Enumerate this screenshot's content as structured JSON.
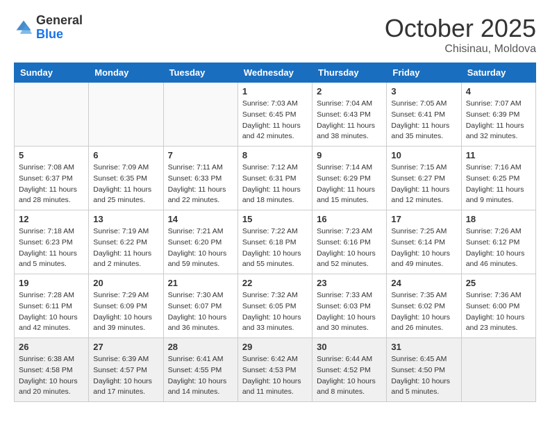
{
  "header": {
    "logo_general": "General",
    "logo_blue": "Blue",
    "month": "October 2025",
    "location": "Chisinau, Moldova"
  },
  "weekdays": [
    "Sunday",
    "Monday",
    "Tuesday",
    "Wednesday",
    "Thursday",
    "Friday",
    "Saturday"
  ],
  "weeks": [
    [
      {
        "day": "",
        "info": ""
      },
      {
        "day": "",
        "info": ""
      },
      {
        "day": "",
        "info": ""
      },
      {
        "day": "1",
        "info": "Sunrise: 7:03 AM\nSunset: 6:45 PM\nDaylight: 11 hours\nand 42 minutes."
      },
      {
        "day": "2",
        "info": "Sunrise: 7:04 AM\nSunset: 6:43 PM\nDaylight: 11 hours\nand 38 minutes."
      },
      {
        "day": "3",
        "info": "Sunrise: 7:05 AM\nSunset: 6:41 PM\nDaylight: 11 hours\nand 35 minutes."
      },
      {
        "day": "4",
        "info": "Sunrise: 7:07 AM\nSunset: 6:39 PM\nDaylight: 11 hours\nand 32 minutes."
      }
    ],
    [
      {
        "day": "5",
        "info": "Sunrise: 7:08 AM\nSunset: 6:37 PM\nDaylight: 11 hours\nand 28 minutes."
      },
      {
        "day": "6",
        "info": "Sunrise: 7:09 AM\nSunset: 6:35 PM\nDaylight: 11 hours\nand 25 minutes."
      },
      {
        "day": "7",
        "info": "Sunrise: 7:11 AM\nSunset: 6:33 PM\nDaylight: 11 hours\nand 22 minutes."
      },
      {
        "day": "8",
        "info": "Sunrise: 7:12 AM\nSunset: 6:31 PM\nDaylight: 11 hours\nand 18 minutes."
      },
      {
        "day": "9",
        "info": "Sunrise: 7:14 AM\nSunset: 6:29 PM\nDaylight: 11 hours\nand 15 minutes."
      },
      {
        "day": "10",
        "info": "Sunrise: 7:15 AM\nSunset: 6:27 PM\nDaylight: 11 hours\nand 12 minutes."
      },
      {
        "day": "11",
        "info": "Sunrise: 7:16 AM\nSunset: 6:25 PM\nDaylight: 11 hours\nand 9 minutes."
      }
    ],
    [
      {
        "day": "12",
        "info": "Sunrise: 7:18 AM\nSunset: 6:23 PM\nDaylight: 11 hours\nand 5 minutes."
      },
      {
        "day": "13",
        "info": "Sunrise: 7:19 AM\nSunset: 6:22 PM\nDaylight: 11 hours\nand 2 minutes."
      },
      {
        "day": "14",
        "info": "Sunrise: 7:21 AM\nSunset: 6:20 PM\nDaylight: 10 hours\nand 59 minutes."
      },
      {
        "day": "15",
        "info": "Sunrise: 7:22 AM\nSunset: 6:18 PM\nDaylight: 10 hours\nand 55 minutes."
      },
      {
        "day": "16",
        "info": "Sunrise: 7:23 AM\nSunset: 6:16 PM\nDaylight: 10 hours\nand 52 minutes."
      },
      {
        "day": "17",
        "info": "Sunrise: 7:25 AM\nSunset: 6:14 PM\nDaylight: 10 hours\nand 49 minutes."
      },
      {
        "day": "18",
        "info": "Sunrise: 7:26 AM\nSunset: 6:12 PM\nDaylight: 10 hours\nand 46 minutes."
      }
    ],
    [
      {
        "day": "19",
        "info": "Sunrise: 7:28 AM\nSunset: 6:11 PM\nDaylight: 10 hours\nand 42 minutes."
      },
      {
        "day": "20",
        "info": "Sunrise: 7:29 AM\nSunset: 6:09 PM\nDaylight: 10 hours\nand 39 minutes."
      },
      {
        "day": "21",
        "info": "Sunrise: 7:30 AM\nSunset: 6:07 PM\nDaylight: 10 hours\nand 36 minutes."
      },
      {
        "day": "22",
        "info": "Sunrise: 7:32 AM\nSunset: 6:05 PM\nDaylight: 10 hours\nand 33 minutes."
      },
      {
        "day": "23",
        "info": "Sunrise: 7:33 AM\nSunset: 6:03 PM\nDaylight: 10 hours\nand 30 minutes."
      },
      {
        "day": "24",
        "info": "Sunrise: 7:35 AM\nSunset: 6:02 PM\nDaylight: 10 hours\nand 26 minutes."
      },
      {
        "day": "25",
        "info": "Sunrise: 7:36 AM\nSunset: 6:00 PM\nDaylight: 10 hours\nand 23 minutes."
      }
    ],
    [
      {
        "day": "26",
        "info": "Sunrise: 6:38 AM\nSunset: 4:58 PM\nDaylight: 10 hours\nand 20 minutes."
      },
      {
        "day": "27",
        "info": "Sunrise: 6:39 AM\nSunset: 4:57 PM\nDaylight: 10 hours\nand 17 minutes."
      },
      {
        "day": "28",
        "info": "Sunrise: 6:41 AM\nSunset: 4:55 PM\nDaylight: 10 hours\nand 14 minutes."
      },
      {
        "day": "29",
        "info": "Sunrise: 6:42 AM\nSunset: 4:53 PM\nDaylight: 10 hours\nand 11 minutes."
      },
      {
        "day": "30",
        "info": "Sunrise: 6:44 AM\nSunset: 4:52 PM\nDaylight: 10 hours\nand 8 minutes."
      },
      {
        "day": "31",
        "info": "Sunrise: 6:45 AM\nSunset: 4:50 PM\nDaylight: 10 hours\nand 5 minutes."
      },
      {
        "day": "",
        "info": ""
      }
    ]
  ]
}
